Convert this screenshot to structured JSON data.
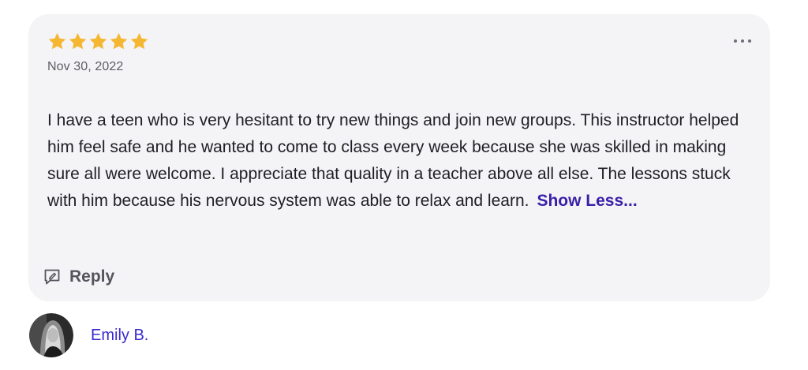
{
  "review": {
    "rating": 5,
    "rating_max": 5,
    "star_color": "#f5b731",
    "date": "Nov 30, 2022",
    "body": "I have a teen who is very hesitant to try new things and join new groups. This instructor helped him feel safe and he wanted to come to class every week because she was skilled in making sure all were welcome. I appreciate that quality in a teacher above all else. The lessons stuck with him because his nervous system was able to relax and learn.",
    "show_less_label": "Show Less...",
    "reply_label": "Reply",
    "icons": {
      "star": "star-icon",
      "more": "more-options-icon",
      "reply": "reply-icon"
    }
  },
  "author": {
    "name": "Emily B.",
    "name_color": "#3a2ad0",
    "avatar": "avatar"
  }
}
